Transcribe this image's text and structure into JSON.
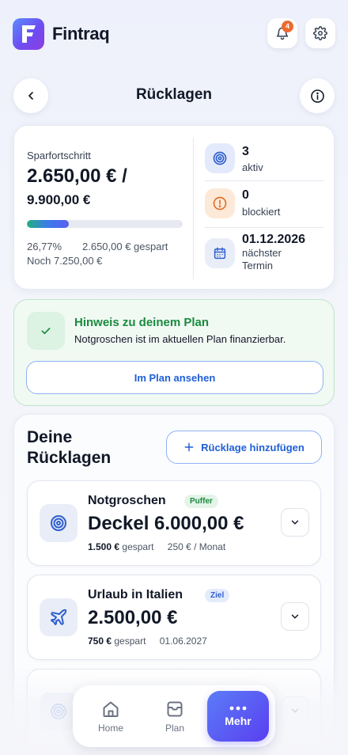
{
  "app": {
    "name": "Fintraq",
    "notifications_count": "4"
  },
  "header": {
    "title": "Rücklagen"
  },
  "progress": {
    "label": "Sparfortschritt",
    "saved_amount": "2.650,00 € /",
    "target_amount": "9.900,00 €",
    "percent_value": 26.77,
    "percent_text": "26,77%",
    "saved_text": "2.650,00 € gespart",
    "remaining_text": "Noch 7.250,00 €"
  },
  "stats": {
    "active": {
      "value": "3",
      "label": "aktiv"
    },
    "blocked": {
      "value": "0",
      "label": "blockiert"
    },
    "next_date": {
      "value": "01.12.2026",
      "label1": "nächster",
      "label2": "Termin"
    }
  },
  "hint": {
    "title": "Hinweis zu deinem Plan",
    "text": "Notgroschen ist im aktuellen Plan finanzierbar.",
    "button_label": "Im Plan ansehen"
  },
  "reserves": {
    "title": "Deine Rücklagen",
    "add_label": "Rücklage hinzufügen",
    "items": [
      {
        "name": "Notgroschen",
        "tag": "Puffer",
        "amount": "Deckel 6.000,00 €",
        "saved": "1.500 €",
        "saved_label": "gespart",
        "extra": "250 € / Monat"
      },
      {
        "name": "Urlaub in Italien",
        "tag": "Ziel",
        "amount": "2.500,00 €",
        "saved": "750 €",
        "saved_label": "gespart",
        "extra": "01.06.2027"
      }
    ]
  },
  "nav": {
    "home": "Home",
    "plan": "Plan",
    "more": "Mehr"
  },
  "colors": {
    "accent": "#1f5fd6",
    "success": "#1a8a3e",
    "warning": "#e0702a",
    "brand_gradient_start": "#5b8cff",
    "brand_gradient_end": "#8f3ce0"
  }
}
